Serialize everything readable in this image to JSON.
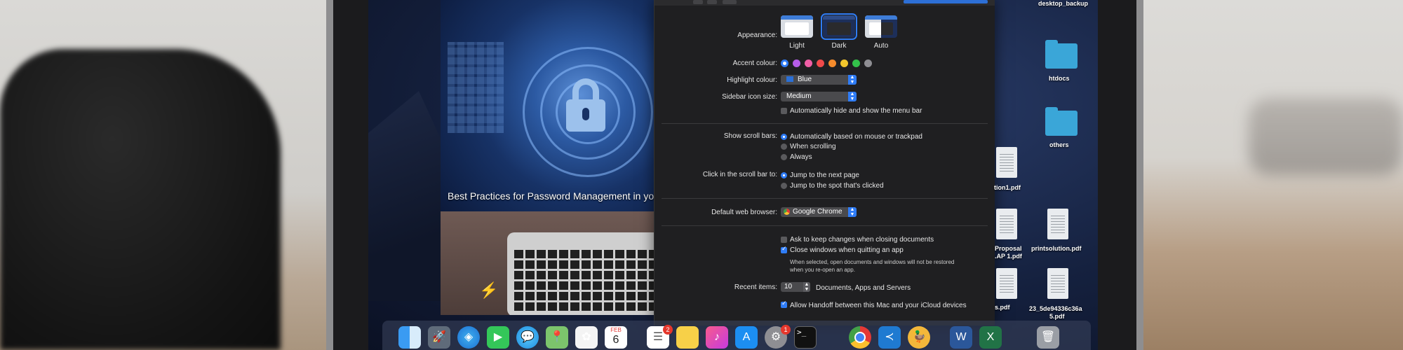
{
  "hero": {
    "title": "Best Practices for Password Management in your"
  },
  "prefs": {
    "appearance_label": "Appearance:",
    "appearance_options": [
      "Light",
      "Dark",
      "Auto"
    ],
    "accent_label": "Accent colour:",
    "accent_colors": [
      "#2f7cf6",
      "#b65de8",
      "#ef5ea5",
      "#f04a4a",
      "#f58b2c",
      "#f2c62d",
      "#33c14a",
      "#8e8e93"
    ],
    "highlight_label": "Highlight colour:",
    "highlight_value": "Blue",
    "sidebar_label": "Sidebar icon size:",
    "sidebar_value": "Medium",
    "autohide_menu": "Automatically hide and show the menu bar",
    "scroll_label": "Show scroll bars:",
    "scroll_options": [
      "Automatically based on mouse or trackpad",
      "When scrolling",
      "Always"
    ],
    "click_label": "Click in the scroll bar to:",
    "click_options": [
      "Jump to the next page",
      "Jump to the spot that's clicked"
    ],
    "browser_label": "Default web browser:",
    "browser_value": "Google Chrome",
    "ask_keep": "Ask to keep changes when closing documents",
    "close_windows": "Close windows when quitting an app",
    "close_note_1": "When selected, open documents and windows will not be restored",
    "close_note_2": "when you re-open an app.",
    "recent_label": "Recent items:",
    "recent_value": "10",
    "recent_suffix": "Documents, Apps and Servers",
    "handoff": "Allow Handoff between this Mac and your iCloud devices"
  },
  "desktop": {
    "top_label": "desktop_backup",
    "folders": [
      "htdocs",
      "others"
    ],
    "files": [
      "tion1.pdf",
      "Proposal",
      ".AP 1.pdf",
      "printsolution.pdf",
      "s.pdf",
      "23_5de94336c36a",
      "5.pdf"
    ]
  },
  "dock": {
    "calendar_month": "FEB",
    "calendar_day": "6",
    "reminders_badge": "2",
    "sysprefs_badge": "1",
    "terminal_glyph": ">_"
  },
  "colors": {
    "accent": "#2f7cf6",
    "window_bg": "#1f1f21",
    "folder": "#3aa6d8"
  }
}
